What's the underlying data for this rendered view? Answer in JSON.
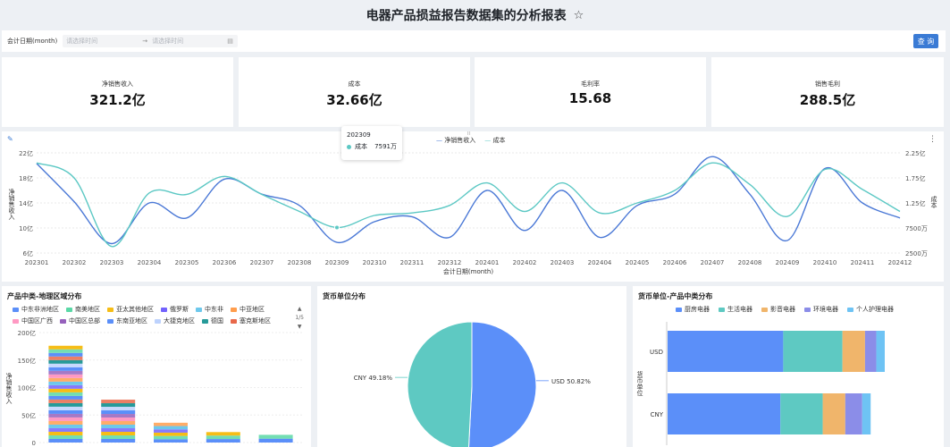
{
  "header": {
    "title": "电器产品损益报告数据集的分析报表"
  },
  "filter": {
    "label": "会计日期(month)",
    "start_placeholder": "请选择时间",
    "end_placeholder": "请选择时间",
    "query_label": "查 询"
  },
  "kpis": [
    {
      "label": "净销售收入",
      "value": "321.2亿"
    },
    {
      "label": "成本",
      "value": "32.66亿"
    },
    {
      "label": "毛利率",
      "value": "15.68"
    },
    {
      "label": "销售毛利",
      "value": "288.5亿"
    }
  ],
  "colors": {
    "blue": "#4a78d6",
    "teal": "#5cc8c4",
    "accent": "#3a7bd5"
  },
  "tooltip": {
    "period": "202309",
    "series": "成本",
    "value": "7591万"
  },
  "chart_data": [
    {
      "type": "line",
      "x": [
        "202301",
        "202302",
        "202303",
        "202304",
        "202305",
        "202306",
        "202307",
        "202308",
        "202309",
        "202310",
        "202311",
        "202312",
        "202401",
        "202402",
        "202403",
        "202404",
        "202405",
        "202406",
        "202407",
        "202408",
        "202409",
        "202410",
        "202411",
        "202412"
      ],
      "xlabel": "会计日期(month)",
      "ylabel": "净销售收入",
      "y2label": "成本",
      "ylim": [
        6,
        22
      ],
      "y_ticks": [
        "6亿",
        "10亿",
        "14亿",
        "18亿",
        "22亿"
      ],
      "y2lim": [
        0.25,
        2.25
      ],
      "y2_ticks": [
        "2500万",
        "7500万",
        "1.25亿",
        "1.75亿",
        "2.25亿"
      ],
      "legend_position": "top-center",
      "series": [
        {
          "name": "净销售收入",
          "axis": "left",
          "color": "#4a78d6",
          "values": [
            20.3,
            14.2,
            7.5,
            14.0,
            11.6,
            17.8,
            15.4,
            13.6,
            7.7,
            11.0,
            11.8,
            8.5,
            16.0,
            9.6,
            16.0,
            8.5,
            13.6,
            15.4,
            21.4,
            15.4,
            8.0,
            19.5,
            14.0,
            11.6
          ]
        },
        {
          "name": "成本",
          "axis": "right",
          "color": "#5cc8c4",
          "values": [
            2.05,
            1.75,
            0.38,
            1.45,
            1.42,
            1.78,
            1.42,
            1.08,
            0.76,
            1.0,
            1.05,
            1.2,
            1.65,
            1.08,
            1.65,
            1.05,
            1.25,
            1.5,
            2.05,
            1.62,
            0.98,
            1.92,
            1.52,
            1.08
          ]
        }
      ]
    },
    {
      "type": "bar",
      "title": "产品中类-地理区域分布",
      "ylabel": "净销售收入",
      "ylim": [
        0,
        200
      ],
      "y_ticks": [
        "0",
        "50亿",
        "100亿",
        "150亿",
        "200亿"
      ],
      "legend_page": "1/5",
      "legend": [
        {
          "name": "中东非洲地区",
          "color": "#5b8ff9"
        },
        {
          "name": "南美地区",
          "color": "#5ad8a6"
        },
        {
          "name": "亚太其他地区",
          "color": "#f6bd16"
        },
        {
          "name": "俄罗斯",
          "color": "#7262fd"
        },
        {
          "name": "中东非",
          "color": "#6dc8ec"
        },
        {
          "name": "中亚地区",
          "color": "#ff9d4d"
        },
        {
          "name": "中国区广西",
          "color": "#ff99c3"
        },
        {
          "name": "中国区总部",
          "color": "#9661bc"
        },
        {
          "name": "东南亚地区",
          "color": "#5b8ff9"
        },
        {
          "name": "大捷克地区",
          "color": "#bdd2fd"
        },
        {
          "name": "德国",
          "color": "#269a99"
        },
        {
          "name": "塞克斯地区",
          "color": "#e8684a"
        }
      ],
      "values": [
        176,
        78,
        36,
        19,
        14
      ]
    },
    {
      "type": "pie",
      "title": "货币单位分布",
      "slices": [
        {
          "name": "USD",
          "value": 50.82,
          "label": "USD 50.82%",
          "color": "#5b8ff9"
        },
        {
          "name": "CNY",
          "value": 49.18,
          "label": "CNY 49.18%",
          "color": "#5ec9c2"
        }
      ]
    },
    {
      "type": "bar",
      "orientation": "horizontal",
      "stacked": true,
      "title": "货币单位-产品中类分布",
      "ylabel": "货币单位",
      "categories": [
        "USD",
        "CNY"
      ],
      "series": [
        {
          "name": "厨房电器",
          "color": "#5b8ff9",
          "values": [
            41,
            40
          ]
        },
        {
          "name": "生活电器",
          "color": "#5ec9c2",
          "values": [
            21,
            15
          ]
        },
        {
          "name": "影音电器",
          "color": "#f0b56b",
          "values": [
            8,
            8
          ]
        },
        {
          "name": "环境电器",
          "color": "#8b8de8",
          "values": [
            4,
            6
          ]
        },
        {
          "name": "个人护理电器",
          "color": "#6ec3f4",
          "values": [
            3,
            3
          ]
        }
      ]
    }
  ]
}
